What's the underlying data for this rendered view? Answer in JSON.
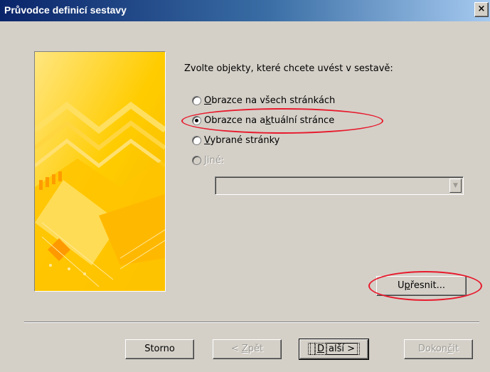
{
  "window": {
    "title": "Průvodce definicí sestavy",
    "close_glyph": "×"
  },
  "main": {
    "prompt": "Zvolte objekty, které chcete uvést v sestavě:",
    "options": [
      {
        "pre": "",
        "mnemonic": "O",
        "post": "brazce na všech stránkách",
        "checked": false,
        "enabled": true
      },
      {
        "pre": "Obrazce na a",
        "mnemonic": "k",
        "post": "tuální stránce",
        "checked": true,
        "enabled": true
      },
      {
        "pre": "",
        "mnemonic": "V",
        "post": "ybrané stránky",
        "checked": false,
        "enabled": true
      },
      {
        "pre": "",
        "mnemonic": "J",
        "post": "iné:",
        "checked": false,
        "enabled": false
      }
    ],
    "other_select": {
      "value": "",
      "arrow_icon": "dropdown-arrow-icon"
    },
    "refine_button": {
      "pre": "U",
      "mnemonic": "p",
      "post": "řesnit..."
    }
  },
  "footer": {
    "cancel": {
      "label": "Storno"
    },
    "back": {
      "pre": "< ",
      "mnemonic": "Z",
      "post": "pět"
    },
    "next": {
      "pre": "",
      "mnemonic": "D",
      "post": "alší >"
    },
    "finish": {
      "pre": "Dokon",
      "mnemonic": "č",
      "post": "it"
    }
  },
  "annotation": {
    "color": "#e8192c"
  },
  "colors": {
    "dialog_bg": "#d4d0c8",
    "titlebar_start": "#0a246a",
    "titlebar_end": "#a6caf0",
    "banner_yellow": "#ffcc00"
  }
}
